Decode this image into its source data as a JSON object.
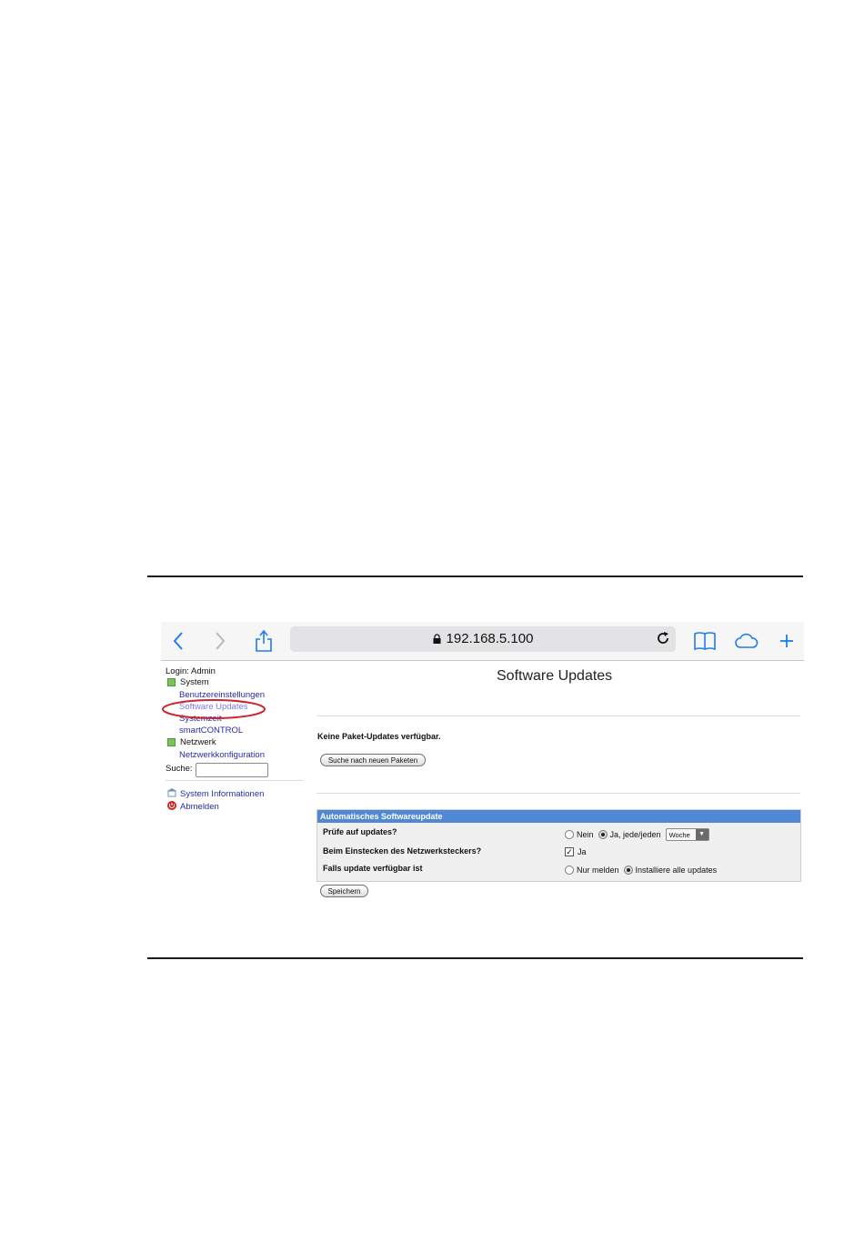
{
  "browser": {
    "address": "192.168.5.100",
    "icons": [
      "back-icon",
      "forward-icon",
      "share-icon",
      "lock-icon",
      "reload-icon",
      "bookmarks-icon",
      "cloud-tabs-icon",
      "new-tab-icon"
    ]
  },
  "sidebar": {
    "login": "Login: Admin",
    "sections": [
      {
        "label": "System",
        "items": [
          "Benutzereinstellungen",
          "Software Updates",
          "Systemzeit",
          "smartCONTROL"
        ]
      },
      {
        "label": "Netzwerk",
        "items": [
          "Netzwerkkonfiguration"
        ]
      }
    ],
    "search_label": "Suche:",
    "links": [
      "System Informationen",
      "Abmelden"
    ]
  },
  "main": {
    "title": "Software Updates",
    "status": "Keine Paket-Updates verfügbar.",
    "search_button": "Suche nach neuen Paketen",
    "auto_update": {
      "header": "Automatisches Softwareupdate",
      "rows": [
        {
          "label": "Prüfe auf updates?",
          "option_no": "Nein",
          "option_yes": "Ja, jede/jeden",
          "interval": "Woche",
          "selected": "Ja, jede/jeden"
        },
        {
          "label": "Beim Einstecken des Netzwerksteckers?",
          "checkbox_label": "Ja",
          "checked": true
        },
        {
          "label": "Falls update verfügbar ist",
          "option_report": "Nur melden",
          "option_install": "Installiere alle updates",
          "selected": "Installiere alle updates"
        }
      ]
    },
    "save_button": "Speichern"
  },
  "colors": {
    "accent": "#5088d6",
    "link": "#2a2aa8",
    "highlight": "#d2232a",
    "safari_blue": "#1e7cf2"
  }
}
